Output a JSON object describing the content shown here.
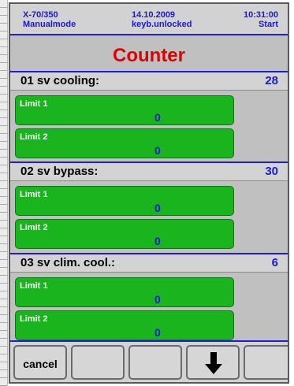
{
  "header": {
    "device": "X-70/350",
    "mode": "Manualmode",
    "date": "14.10.2009",
    "keyboard": "keyb.unlocked",
    "time": "10:31:00",
    "status": "Start"
  },
  "title": "Counter",
  "sections": [
    {
      "name": "01  sv cooling:",
      "count": "28",
      "limits": [
        {
          "label": "Limit 1",
          "value": "0"
        },
        {
          "label": "Limit 2",
          "value": "0"
        }
      ]
    },
    {
      "name": "02  sv bypass:",
      "count": "30",
      "limits": [
        {
          "label": "Limit 1",
          "value": "0"
        },
        {
          "label": "Limit 2",
          "value": "0"
        }
      ]
    },
    {
      "name": "03  sv clim. cool.:",
      "count": "6",
      "limits": [
        {
          "label": "Limit 1",
          "value": "0"
        },
        {
          "label": "Limit 2",
          "value": "0"
        }
      ]
    }
  ],
  "function_keys": [
    {
      "label": "cancel",
      "icon": ""
    },
    {
      "label": "",
      "icon": ""
    },
    {
      "label": "",
      "icon": ""
    },
    {
      "label": "",
      "icon": "arrow-down-icon"
    },
    {
      "label": "",
      "icon": ""
    }
  ],
  "colors": {
    "accent_blue": "#1a1ad6",
    "title_red": "#e00000",
    "limit_green": "#19b41e"
  }
}
